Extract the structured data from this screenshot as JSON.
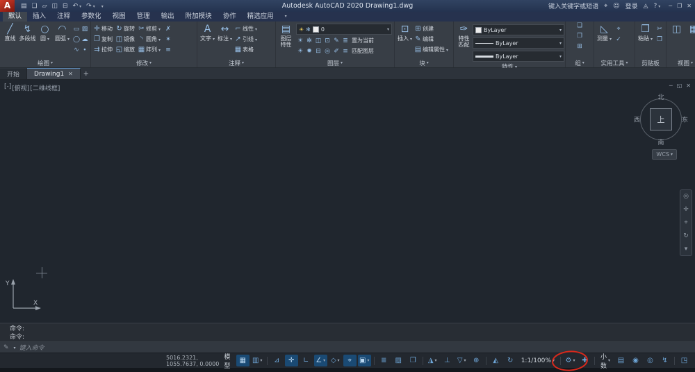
{
  "titlebar": {
    "title": "Autodesk AutoCAD 2020   Drawing1.dwg",
    "search_placeholder": "键入关键字或短语",
    "login": "登录",
    "icons": {
      "logo": "A",
      "menu": "▤",
      "new_file": "❏",
      "open": "▱",
      "save": "◫",
      "plot": "⊟",
      "undo": "↶",
      "redo": "↷",
      "search": "⌖",
      "user": "☺",
      "store": "◬",
      "help": "?",
      "min": "─",
      "max": "❐",
      "close": "✕"
    }
  },
  "ribbon": {
    "tabs": [
      {
        "label": "默认"
      },
      {
        "label": "插入"
      },
      {
        "label": "注释"
      },
      {
        "label": "参数化"
      },
      {
        "label": "视图"
      },
      {
        "label": "管理"
      },
      {
        "label": "输出"
      },
      {
        "label": "附加模块"
      },
      {
        "label": "协作"
      },
      {
        "label": "精选应用"
      }
    ],
    "panels": {
      "draw": {
        "label": "绘图",
        "line": "直线",
        "pline": "多段线",
        "circle": "圆",
        "arc": "圆弧",
        "icons": {
          "line": "╱",
          "pline": "↯",
          "circle": "○",
          "arc": "◠",
          "rect": "▭",
          "hatch": "▨",
          "ellipse": "◯",
          "cloud": "☁",
          "spline": "∿",
          "point": "∙"
        }
      },
      "modify": {
        "label": "修改",
        "move": "移动",
        "rotate": "旋转",
        "trim": "修剪",
        "copy": "复制",
        "mirror": "镜像",
        "fillet": "圆角",
        "stretch": "拉伸",
        "scale": "缩放",
        "array": "阵列",
        "icons": {
          "move": "✛",
          "rotate": "↻",
          "trim": "✂",
          "copy": "❐",
          "mirror": "◫",
          "fillet": "◝",
          "stretch": "⇉",
          "scale": "◱",
          "array": "▦",
          "erase": "✗",
          "explode": "✶",
          "offset": "≡"
        }
      },
      "annotate": {
        "label": "注释",
        "text": "文字",
        "dim": "标注",
        "linear": "线性",
        "leader": "引线",
        "table": "表格",
        "icons": {
          "text": "A",
          "dim": "↔",
          "linear": "⌐",
          "leader": "↗",
          "table": "▦"
        }
      },
      "layers": {
        "label": "图层",
        "properties": "图层特性",
        "current": "0",
        "make_current": "置为当前",
        "match": "匹配图层",
        "icons": {
          "props": "▤",
          "on": "☀",
          "freeze": "✻"
        },
        "row1": [
          "☀",
          "✻",
          "◫",
          "⊡",
          "✎",
          "≣"
        ],
        "row2": [
          "☀",
          "✹",
          "⊟",
          "◎",
          "✐",
          "≡"
        ]
      },
      "block": {
        "label": "块",
        "insert": "插入",
        "create": "创建",
        "edit": "编辑",
        "edit_attr": "编辑属性",
        "icons": {
          "insert": "⊡",
          "create": "⊞",
          "edit": "✎",
          "attr": "▤"
        }
      },
      "props": {
        "label": "特性",
        "match": "特性匹配",
        "bylayer": "ByLayer",
        "icons": {
          "brush": "✑"
        }
      },
      "groups": {
        "label": "组",
        "icons": {
          "group": "❏",
          "ungroup": "❐",
          "edit": "⊞"
        }
      },
      "utils": {
        "label": "实用工具",
        "measure": "测量",
        "icons": {
          "measure": "◺",
          "idpoint": "⌖",
          "qcalc": "✓"
        }
      },
      "clip": {
        "label": "剪贴板",
        "paste": "粘贴",
        "icons": {
          "paste": "❒",
          "cut": "✂",
          "copy": "❐"
        }
      },
      "view": {
        "label": "视图",
        "icons": {
          "a": "◫",
          "b": "▦"
        }
      }
    }
  },
  "file_tabs": {
    "start": "开始",
    "drawing": "Drawing1",
    "close": "✕",
    "add": "+"
  },
  "viewport": {
    "controls": {
      "minus": "[-]",
      "view": "[俯视]",
      "visual": "[二维线框]"
    },
    "win": {
      "min": "─",
      "restore": "◱",
      "close": "✕"
    },
    "viewcube": {
      "n": "北",
      "s": "南",
      "w": "西",
      "e": "东",
      "top": "上",
      "wcs": "WCS"
    },
    "ucs": {
      "x": "X",
      "y": "Y"
    },
    "navbar": [
      "◎",
      "✛",
      "⌖",
      "↻",
      "▾"
    ]
  },
  "command": {
    "line1": "命令:",
    "line2": "命令:",
    "placeholder": "键入命令",
    "icons": {
      "customize": "✎"
    }
  },
  "statusbar": {
    "coords": "5016.2321, 1055.7637, 0.0000",
    "model": "模型",
    "scale": "1:1/100%",
    "units": "小数",
    "icons": {
      "grid": "▦",
      "snap": "▥",
      "infer": "⊿",
      "dyninput": "✛",
      "ortho": "∟",
      "polar": "∠",
      "iso": "◇",
      "otrack": "⌖",
      "osnap": "▣",
      "lineweight": "≣",
      "transparency": "▨",
      "cycling": "❐",
      "osnap3d": "◮",
      "ducs": "⊥",
      "filter": "▽",
      "gizmo": "⊕",
      "annovis": "◭",
      "autoscale": "↻",
      "gear": "⚙",
      "monitor": "✚",
      "qprops": "▤",
      "lockui": "◉",
      "isolate": "◎",
      "perf": "↯",
      "clean": "◳"
    }
  }
}
